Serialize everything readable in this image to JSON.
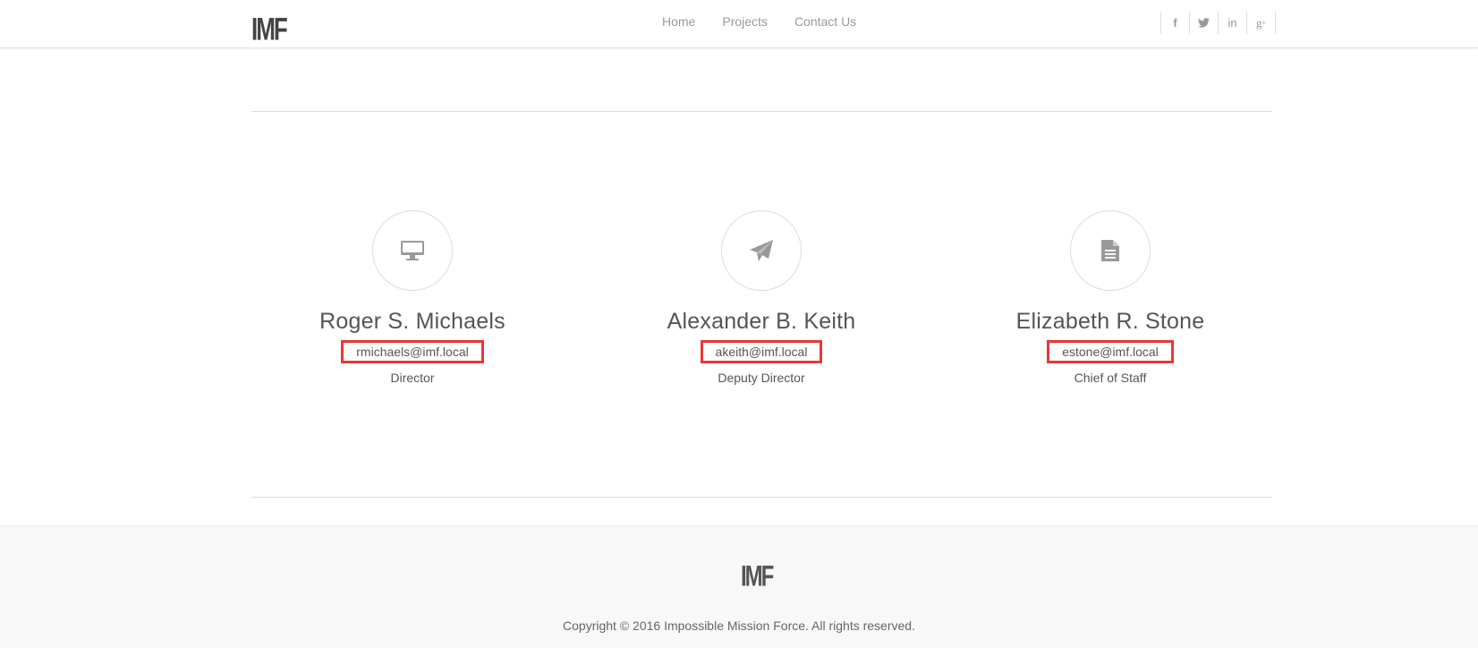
{
  "header": {
    "logo": "IMF",
    "nav": [
      "Home",
      "Projects",
      "Contact Us"
    ],
    "social_icons": [
      {
        "name": "facebook-icon",
        "glyph": "f"
      },
      {
        "name": "twitter-icon",
        "glyph": "🐦"
      },
      {
        "name": "linkedin-icon",
        "glyph": "in"
      },
      {
        "name": "google-plus-icon",
        "glyph": "g+"
      }
    ]
  },
  "team": [
    {
      "icon": "desktop-icon",
      "name": "Roger S. Michaels",
      "email": "rmichaels@imf.local",
      "role": "Director"
    },
    {
      "icon": "paper-plane-icon",
      "name": "Alexander B. Keith",
      "email": "akeith@imf.local",
      "role": "Deputy Director"
    },
    {
      "icon": "document-icon",
      "name": "Elizabeth R. Stone",
      "email": "estone@imf.local",
      "role": "Chief of Staff"
    }
  ],
  "footer": {
    "logo": "IMF",
    "copyright": "Copyright © 2016 Impossible Mission Force. All rights reserved."
  },
  "colors": {
    "highlight_box": "#e53935",
    "icon_gray": "#999999",
    "footer_bg": "#f8f8f8"
  }
}
